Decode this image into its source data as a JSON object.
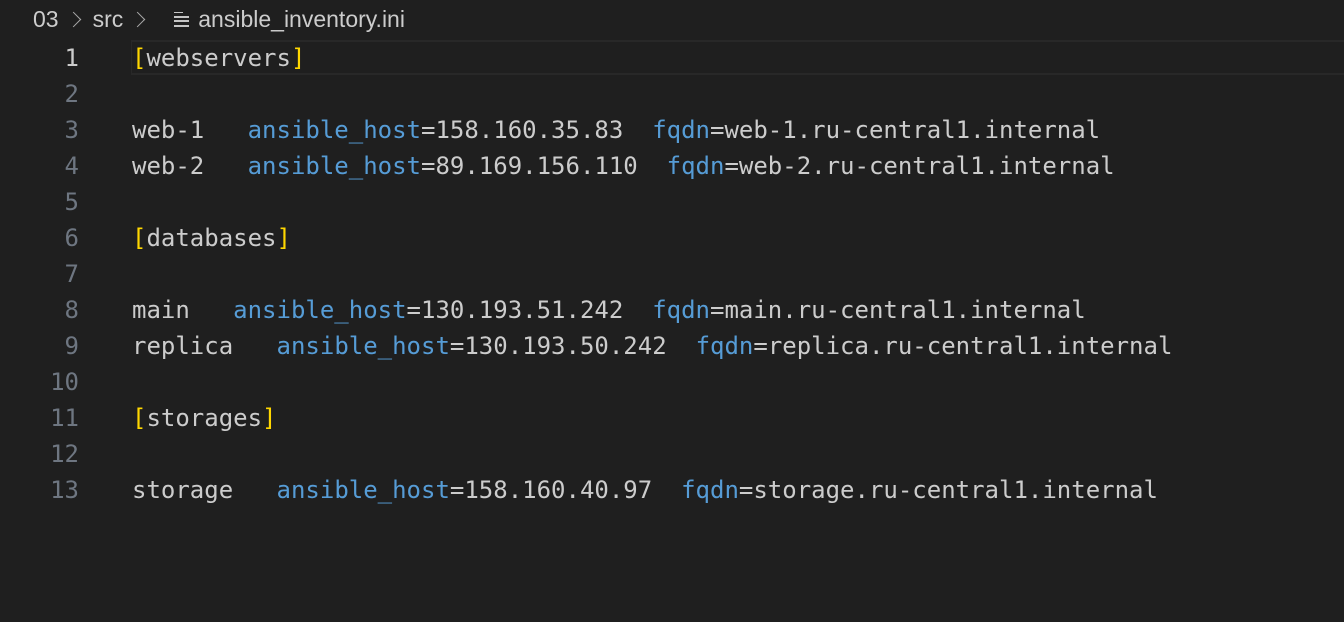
{
  "breadcrumb": {
    "segments": [
      "03",
      "src"
    ],
    "file_icon": "file-lines-icon",
    "file_name": "ansible_inventory.ini"
  },
  "editor": {
    "active_line": 1,
    "colors": {
      "background": "#1f1f1f",
      "line_number": "#6e7681",
      "text": "#cccccc",
      "bracket": "#ffd700",
      "key": "#569cd6"
    },
    "line_numbers": [
      "1",
      "2",
      "3",
      "4",
      "5",
      "6",
      "7",
      "8",
      "9",
      "10",
      "11",
      "12",
      "13"
    ],
    "sections": {
      "webservers": "webservers",
      "databases": "databases",
      "storages": "storages"
    },
    "hosts": [
      {
        "name": "web-1",
        "key1": "ansible_host",
        "ip": "158.160.35.83",
        "key2": "fqdn",
        "fqdn": "web-1.ru-central1.internal"
      },
      {
        "name": "web-2",
        "key1": "ansible_host",
        "ip": "89.169.156.110",
        "key2": "fqdn",
        "fqdn": "web-2.ru-central1.internal"
      },
      {
        "name": "main",
        "key1": "ansible_host",
        "ip": "130.193.51.242",
        "key2": "fqdn",
        "fqdn": "main.ru-central1.internal"
      },
      {
        "name": "replica",
        "key1": "ansible_host",
        "ip": "130.193.50.242",
        "key2": "fqdn",
        "fqdn": "replica.ru-central1.internal"
      },
      {
        "name": "storage",
        "key1": "ansible_host",
        "ip": "158.160.40.97",
        "key2": "fqdn",
        "fqdn": "storage.ru-central1.internal"
      }
    ]
  }
}
